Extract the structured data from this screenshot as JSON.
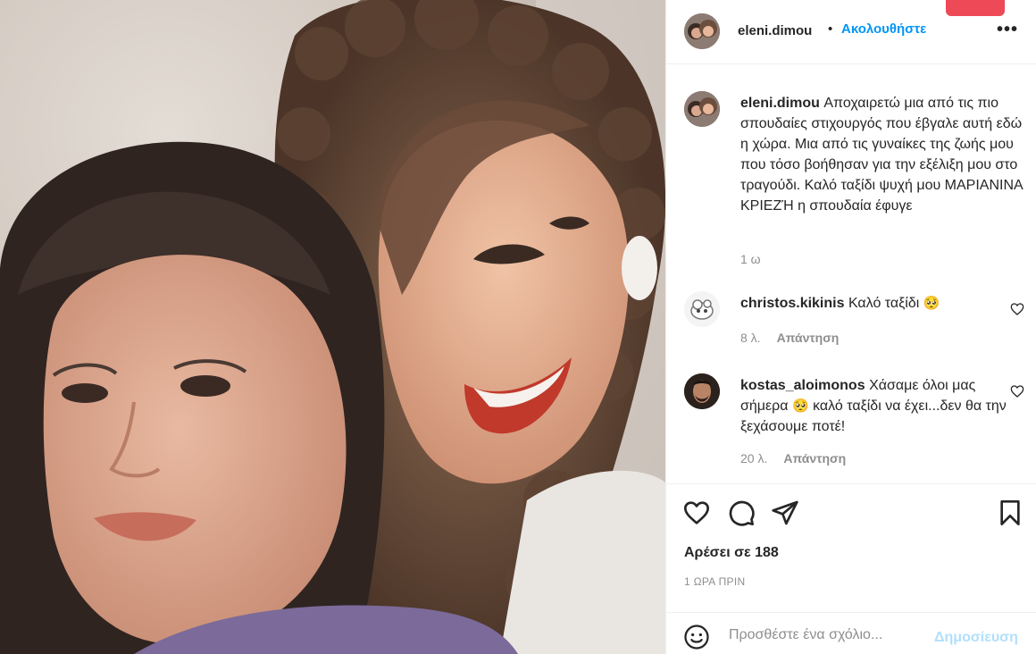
{
  "post": {
    "username": "eleni.dimou",
    "dot": "•",
    "follow_label": "Ακολουθήστε",
    "more_label": "•••",
    "caption": "Αποχαιρετώ μια από τις πιο σπουδαίες στιχουργός που έβγαλε αυτή εδώ η χώρα. Μια από τις γυναίκες της ζωής μου που τόσο βοήθησαν για την εξέλιξη μου στο τραγούδι. Καλό ταξίδι ψυχή μου ΜΑΡΙΑΝΙΝΑ ΚΡΙΕΖΉ η σπουδαία έφυγε",
    "caption_time": "1 ω"
  },
  "comments": [
    {
      "username": "christos.kikinis",
      "text": "Καλό ταξίδι",
      "emoji": "🥺",
      "time": "8 λ.",
      "reply": "Απάντηση"
    },
    {
      "username": "kostas_aloimonos",
      "text_before": "Χάσαμε όλοι μας σήμερα",
      "emoji": "🥺",
      "text_after": "καλό ταξίδι να έχει...δεν θα την ξεχάσουμε ποτέ!",
      "time": "20 λ.",
      "reply": "Απάντηση"
    }
  ],
  "stats": {
    "likes_label": "Αρέσει σε 188",
    "posted_ago": "1 ΩΡΑ ΠΡΙΝ"
  },
  "composer": {
    "placeholder": "Προσθέστε ένα σχόλιο...",
    "post_label": "Δημοσίευση"
  },
  "icons": {
    "like": "heart-icon",
    "comment": "comment-bubble-icon",
    "share": "paper-plane-icon",
    "save": "bookmark-icon",
    "emoji": "smiley-icon",
    "options": "more-horizontal-icon"
  },
  "colors": {
    "accent": "#0095f6",
    "accent_disabled": "#b2dffc",
    "text": "#262626",
    "muted": "#8e8e8e",
    "notification": "#ed4956"
  }
}
